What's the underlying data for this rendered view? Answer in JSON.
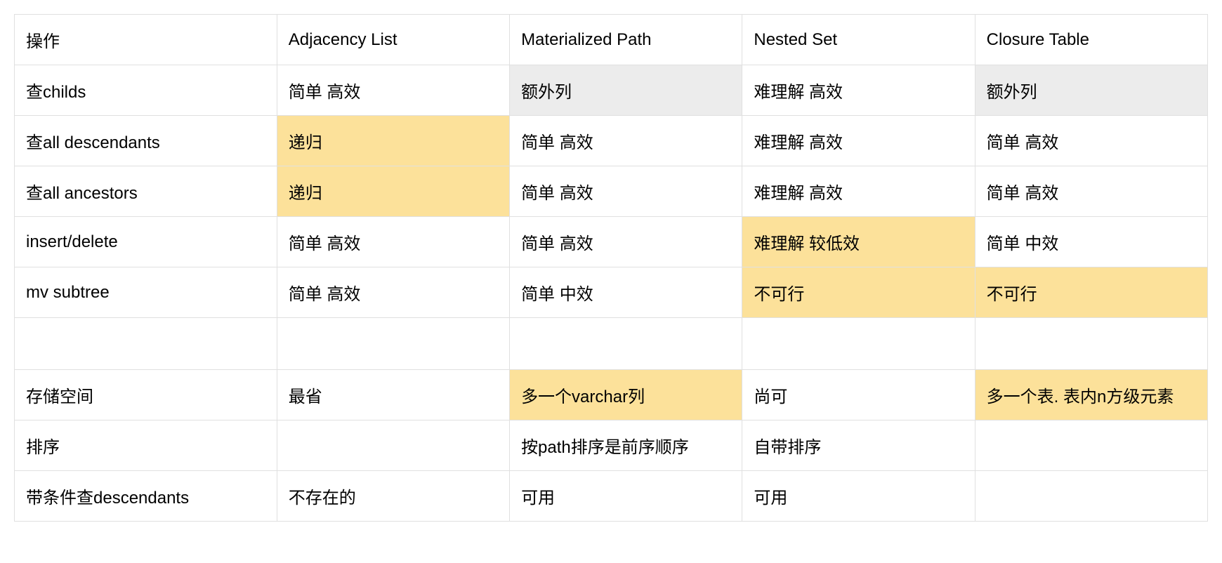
{
  "headers": {
    "col0": "操作",
    "col1": "Adjacency List",
    "col2": "Materialized Path",
    "col3": "Nested Set",
    "col4": "Closure Table"
  },
  "rows": {
    "r1": {
      "op": "查childs",
      "c1": "简单 高效",
      "c2": "额外列",
      "c3": "难理解 高效",
      "c4": "额外列"
    },
    "r2": {
      "op": "查all descendants",
      "c1": "递归",
      "c2": "简单 高效",
      "c3": "难理解 高效",
      "c4": "简单 高效"
    },
    "r3": {
      "op": "查all ancestors",
      "c1": "递归",
      "c2": "简单 高效",
      "c3": "难理解 高效",
      "c4": "简单 高效"
    },
    "r4": {
      "op": "insert/delete",
      "c1": "简单 高效",
      "c2": "简单 高效",
      "c3": "难理解 较低效",
      "c4": "简单 中效"
    },
    "r5": {
      "op": "mv subtree",
      "c1": "简单 高效",
      "c2": "简单 中效",
      "c3": "不可行",
      "c4": "不可行"
    },
    "r6": {
      "op": "",
      "c1": "",
      "c2": "",
      "c3": "",
      "c4": ""
    },
    "r7": {
      "op": "存储空间",
      "c1": "最省",
      "c2": "多一个varchar列",
      "c3": "尚可",
      "c4": "多一个表. 表内n方级元素"
    },
    "r8": {
      "op": "排序",
      "c1": "",
      "c2": "按path排序是前序顺序",
      "c3": "自带排序",
      "c4": ""
    },
    "r9": {
      "op": "带条件查descendants",
      "c1": "不存在的",
      "c2": "可用",
      "c3": "可用",
      "c4": ""
    }
  },
  "chart_data": {
    "type": "table",
    "title": "Tree Storage Model Comparison",
    "columns": [
      "操作",
      "Adjacency List",
      "Materialized Path",
      "Nested Set",
      "Closure Table"
    ],
    "rows": [
      [
        "查childs",
        "简单 高效",
        "额外列",
        "难理解 高效",
        "额外列"
      ],
      [
        "查all descendants",
        "递归",
        "简单 高效",
        "难理解 高效",
        "简单 高效"
      ],
      [
        "查all ancestors",
        "递归",
        "简单 高效",
        "难理解 高效",
        "简单 高效"
      ],
      [
        "insert/delete",
        "简单 高效",
        "简单 高效",
        "难理解 较低效",
        "简单 中效"
      ],
      [
        "mv subtree",
        "简单 高效",
        "简单 中效",
        "不可行",
        "不可行"
      ],
      [
        "",
        "",
        "",
        "",
        ""
      ],
      [
        "存储空间",
        "最省",
        "多一个varchar列",
        "尚可",
        "多一个表. 表内n方级元素"
      ],
      [
        "排序",
        "",
        "按path排序是前序顺序",
        "自带排序",
        ""
      ],
      [
        "带条件查descendants",
        "不存在的",
        "可用",
        "可用",
        ""
      ]
    ],
    "highlight_yellow_cells": [
      [
        1,
        1
      ],
      [
        2,
        1
      ],
      [
        3,
        3
      ],
      [
        4,
        3
      ],
      [
        4,
        4
      ],
      [
        6,
        2
      ],
      [
        6,
        4
      ]
    ],
    "highlight_gray_cells": [
      [
        0,
        2
      ],
      [
        0,
        4
      ]
    ]
  }
}
